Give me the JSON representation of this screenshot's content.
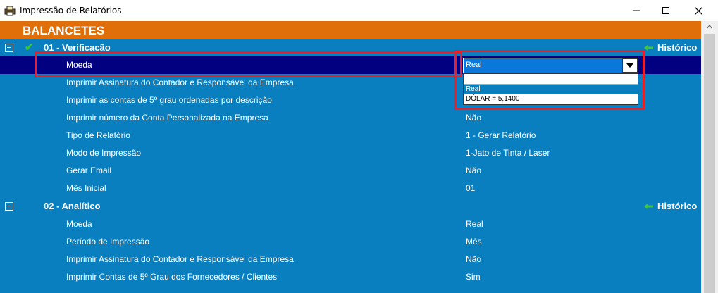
{
  "window": {
    "title": "Impressão de Relatórios",
    "buttons": {
      "minimize": "minimize-icon",
      "maximize": "maximize-icon",
      "close": "close-icon"
    }
  },
  "colors": {
    "content_bg": "#0a7fc0",
    "header_band": "#e06f0a",
    "selected_row": "#020080",
    "highlight_border": "#e8202a",
    "check": "#3ec43e"
  },
  "section_title": "BALANCETES",
  "groups": [
    {
      "label": "01 - Verificação",
      "history": "Histórico",
      "rows": [
        {
          "label": "Moeda",
          "value": "Real"
        },
        {
          "label": "Imprimir Assinatura do Contador e Responsável da Empresa",
          "value": ""
        },
        {
          "label": "Imprimir as contas de 5º grau ordenadas por descrição",
          "value": ""
        },
        {
          "label": "Imprimir número da Conta Personalizada na Empresa",
          "value": "Não"
        },
        {
          "label": "Tipo de Relatório",
          "value": "1 - Gerar Relatório"
        },
        {
          "label": "Modo de Impressão",
          "value": "1-Jato de Tinta / Laser"
        },
        {
          "label": "Gerar Email",
          "value": "Não"
        },
        {
          "label": "Mês Inicial",
          "value": "01"
        }
      ]
    },
    {
      "label": "02 - Analítico",
      "history": "Histórico",
      "rows": [
        {
          "label": "Moeda",
          "value": "Real"
        },
        {
          "label": "Período de Impressão",
          "value": "Mês"
        },
        {
          "label": "Imprimir Assinatura do Contador e Responsável da Empresa",
          "value": "Não"
        },
        {
          "label": "Imprimir Contas de 5º Grau dos Fornecedores / Clientes",
          "value": "Sim"
        }
      ]
    }
  ],
  "dropdown": {
    "current": "Real",
    "options": [
      "",
      "Real",
      "DÓLAR = 5,1400"
    ]
  }
}
